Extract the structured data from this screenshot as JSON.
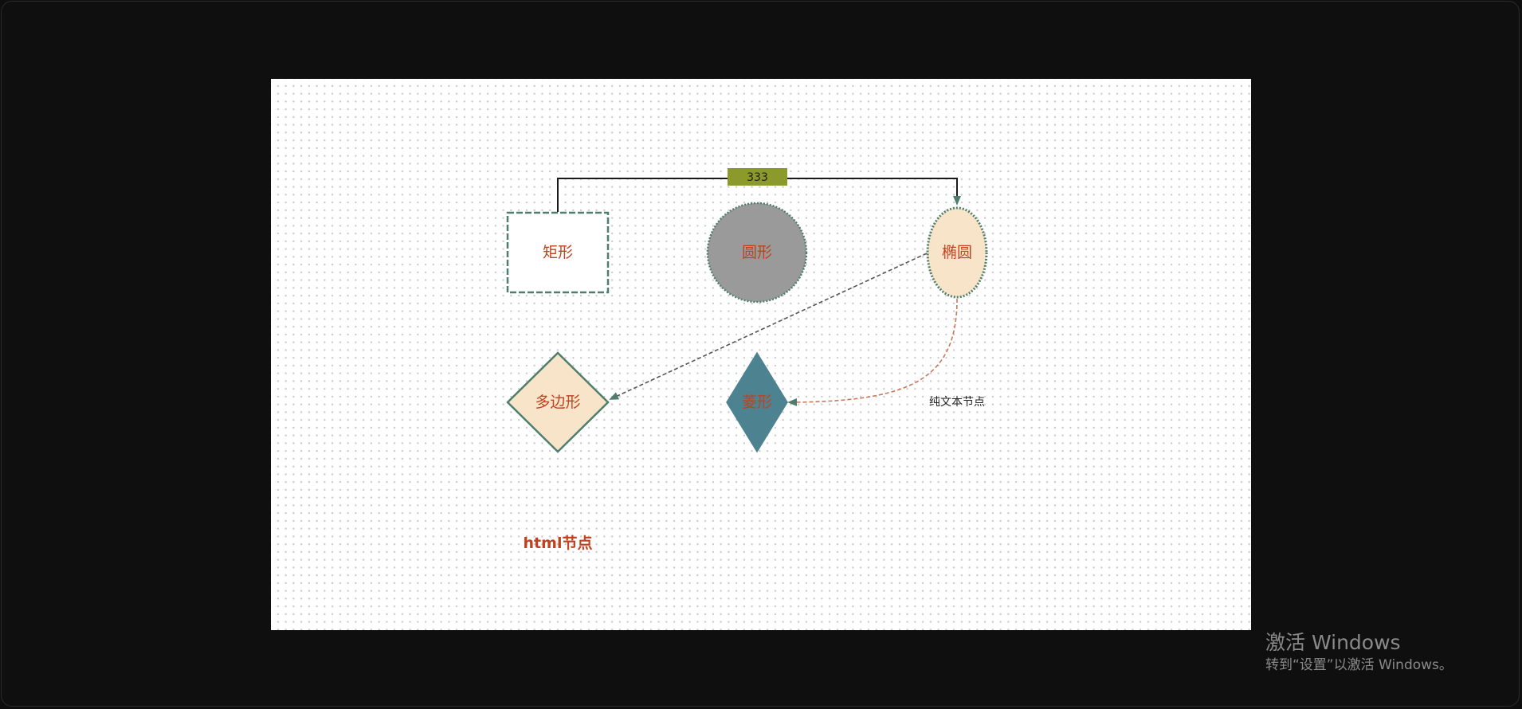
{
  "diagram": {
    "nodes": {
      "rect": {
        "label": "矩形",
        "shape": "rectangle",
        "fill": "#ffffff",
        "stroke": "#4f7f6c",
        "border": "dashed"
      },
      "circle": {
        "label": "圆形",
        "shape": "circle",
        "fill": "#9a9a9a",
        "stroke": "#4f7f6c",
        "border": "dotted"
      },
      "ellipse": {
        "label": "椭圆",
        "shape": "ellipse",
        "fill": "#f8e4c9",
        "stroke": "#4f7f6c",
        "border": "dotted"
      },
      "polygon": {
        "label": "多边形",
        "shape": "diamond",
        "fill": "#f8e4c9",
        "stroke": "#4f7f6c",
        "border": "solid"
      },
      "diamond": {
        "label": "菱形",
        "shape": "diamond",
        "fill": "#4d8390",
        "stroke": "#4d8390",
        "border": "solid"
      },
      "text_node": {
        "label": "纯文本节点",
        "shape": "text"
      },
      "html_node": {
        "label": "html节点",
        "shape": "html"
      }
    },
    "edges": [
      {
        "from": "矩形",
        "to": "椭圆",
        "label": "333",
        "label_bg": "#8c9a2b",
        "style": "solid-orthogonal",
        "color": "#1a1a1a"
      },
      {
        "from": "椭圆",
        "to": "多边形",
        "label": "",
        "style": "dashed-straight",
        "color": "#555555"
      },
      {
        "from": "椭圆",
        "to": "菱形",
        "label": "",
        "style": "dashed-curve",
        "color": "#c9785a"
      }
    ],
    "colors": {
      "label_text": "#c0421f",
      "canvas_bg": "#ffffff",
      "grid_dot": "#c9c9c9",
      "arrowhead": "#4f7f6c"
    }
  },
  "watermark": {
    "title": "激活 Windows",
    "subtitle": "转到“设置”以激活 Windows。"
  }
}
